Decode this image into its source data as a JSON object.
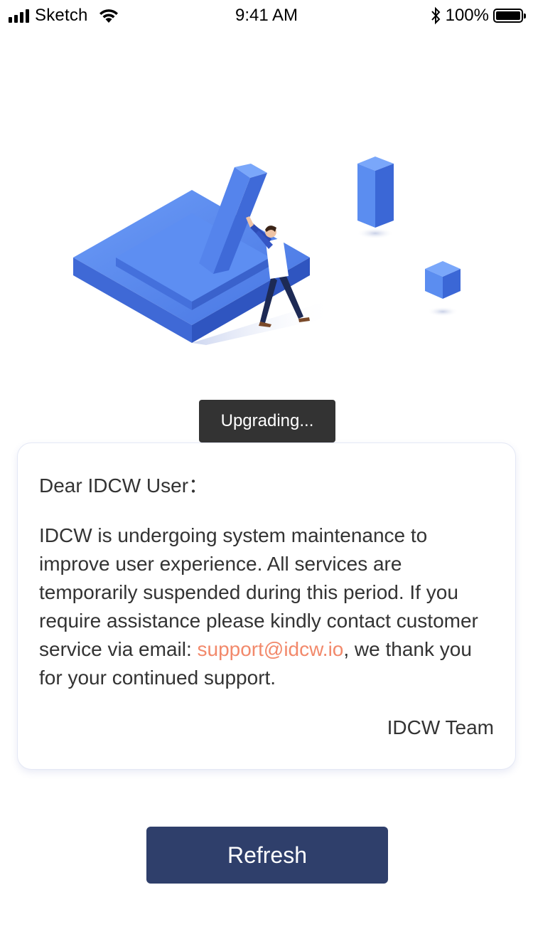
{
  "status_bar": {
    "carrier": "Sketch",
    "time": "9:41 AM",
    "battery_percent": "100%"
  },
  "illustration": {
    "icon": "maintenance-illustration",
    "colors": {
      "block_light": "#5b8df0",
      "block_mid": "#4a78e0",
      "block_dark": "#3459c4"
    }
  },
  "toast": {
    "label": "Upgrading..."
  },
  "notice": {
    "greeting": "Dear IDCW User：",
    "message_before": "IDCW is undergoing system maintenance to improve user experience. All services are temporarily suspended during this period. If you require assistance please kindly contact customer service via email: ",
    "email": "support@idcw.io",
    "message_after": ", we thank you for your continued support.",
    "signature": "IDCW Team"
  },
  "refresh_button": {
    "label": "Refresh"
  },
  "colors": {
    "button": "#2f3f6b",
    "link": "#f2896b",
    "toast": "#333333"
  }
}
